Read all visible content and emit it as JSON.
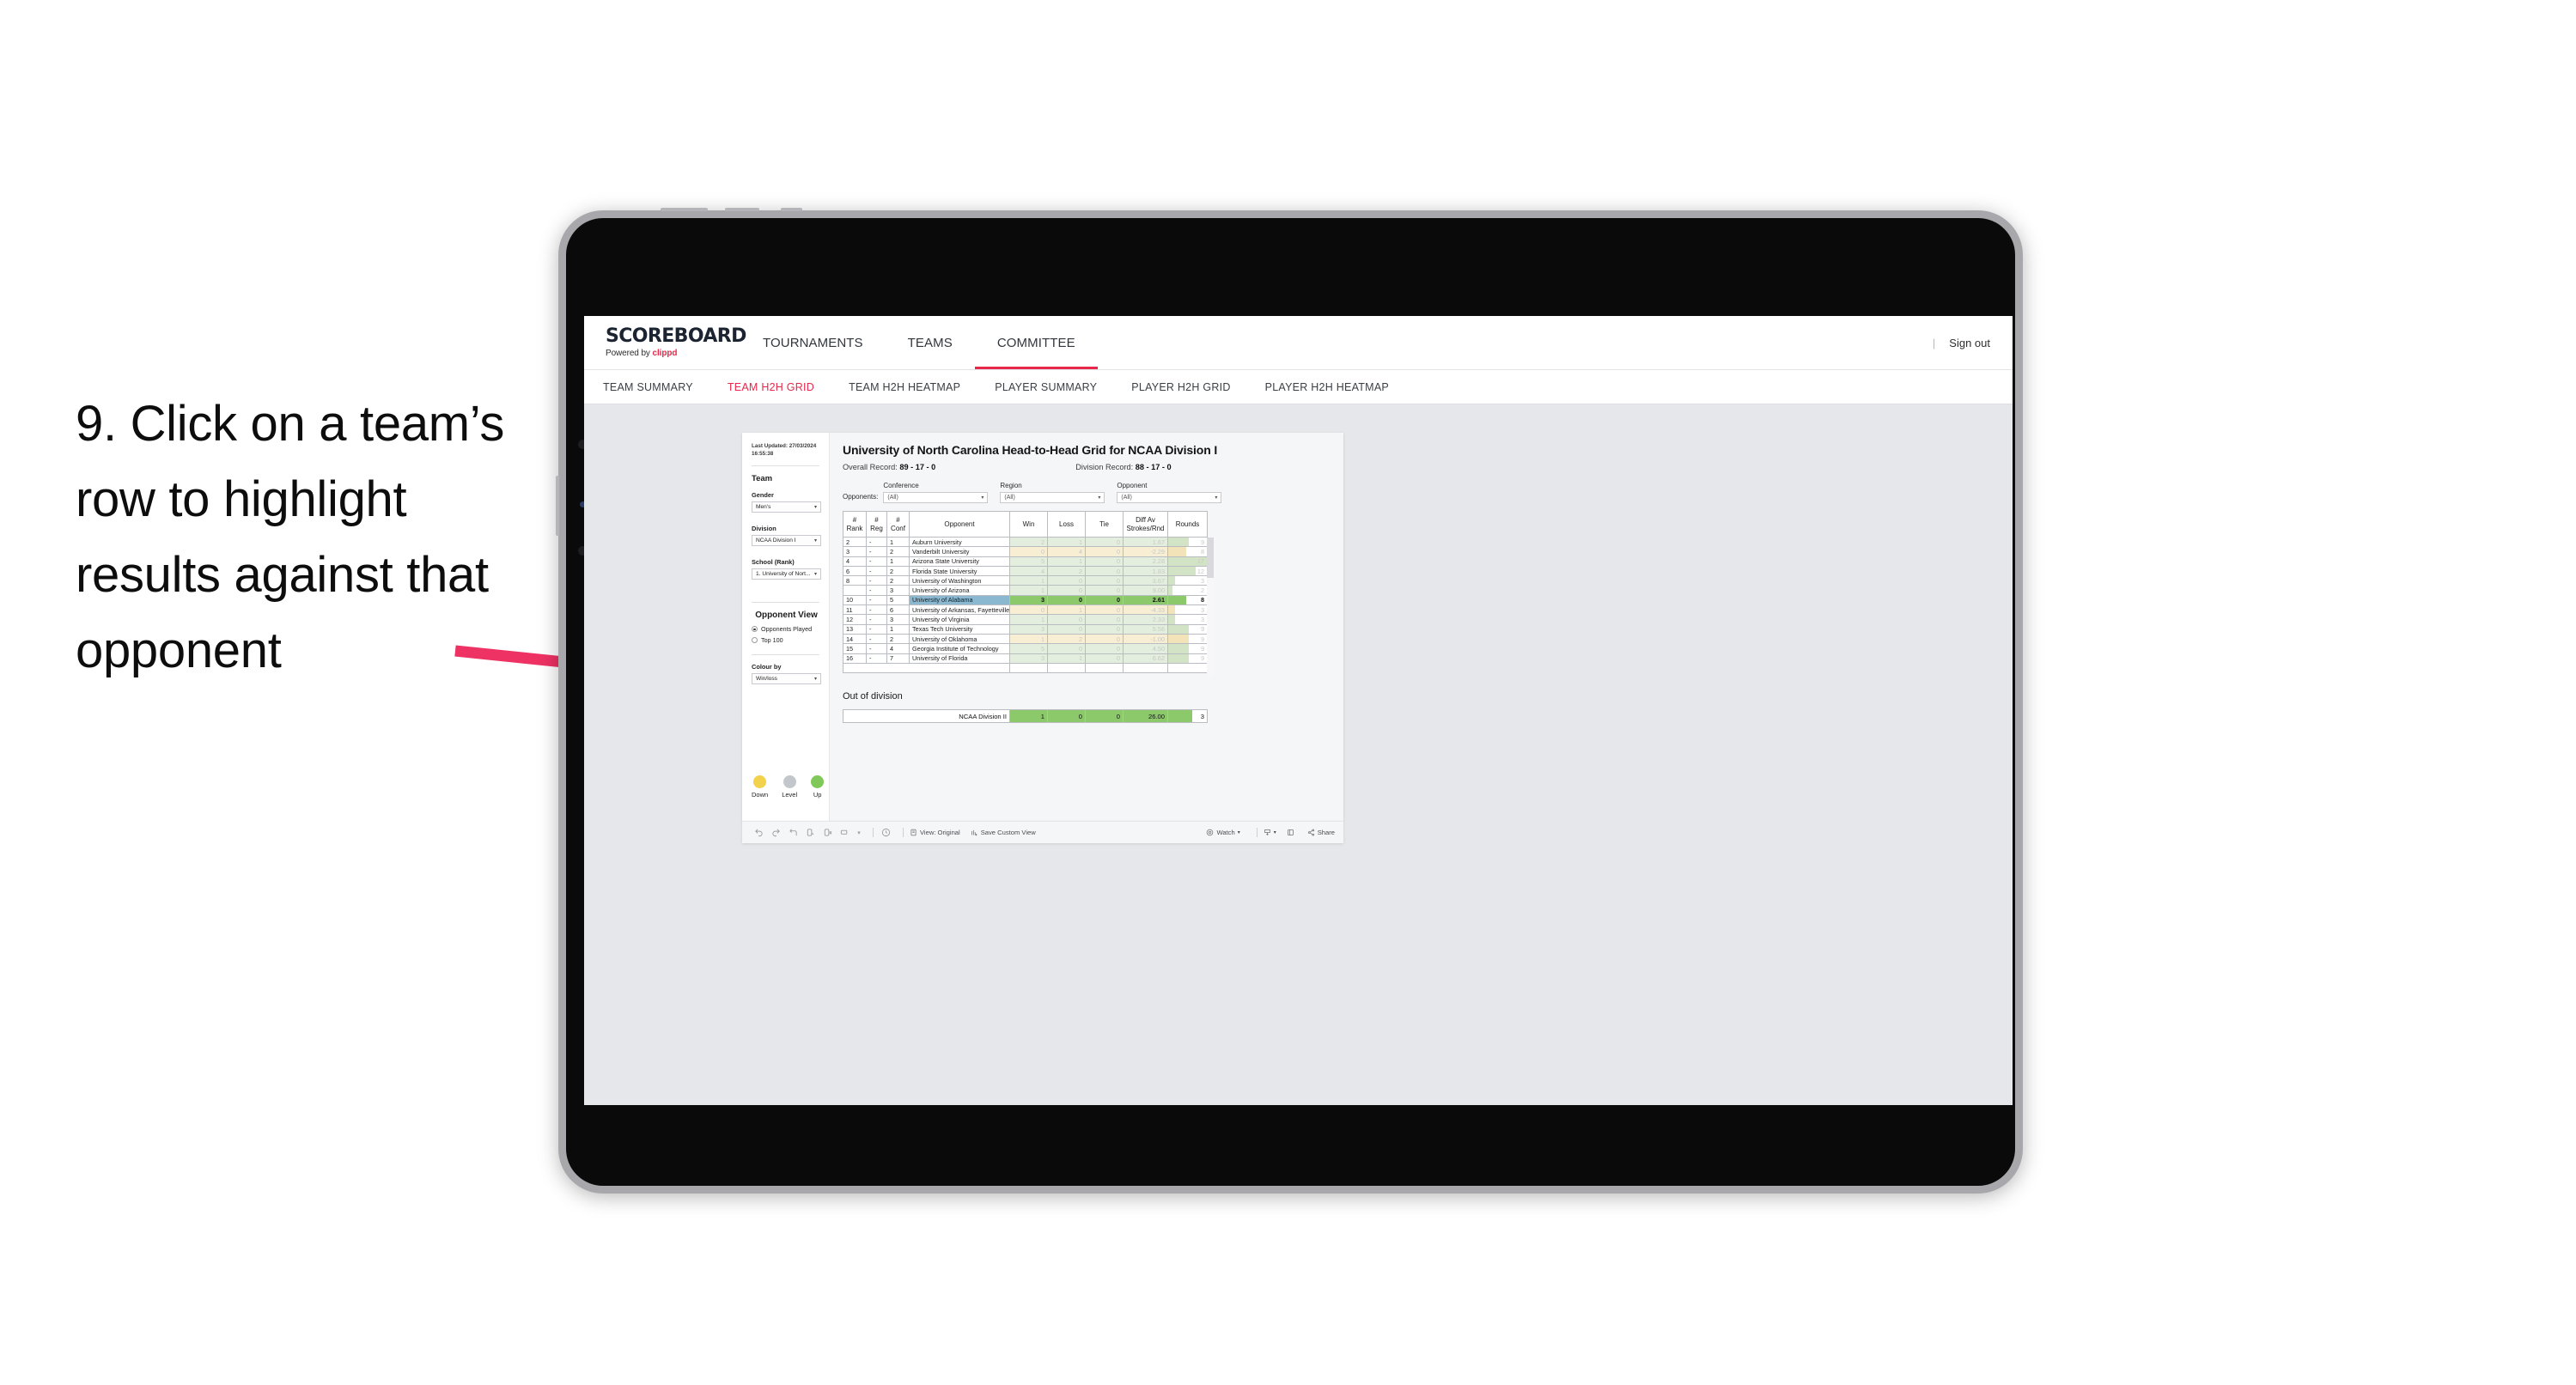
{
  "annotation": {
    "text": "9. Click on a team’s row to highlight results against that opponent",
    "arrow_color": "#ee3264"
  },
  "app": {
    "brand_name": "SCOREBOARD",
    "brand_sub_prefix": "Powered by ",
    "brand_sub_clippd": "clippd",
    "signout": "Sign out",
    "divider": "|",
    "topnav": [
      {
        "label": "TOURNAMENTS",
        "active": false
      },
      {
        "label": "TEAMS",
        "active": false
      },
      {
        "label": "COMMITTEE",
        "active": true
      }
    ],
    "subnav": [
      {
        "label": "TEAM SUMMARY",
        "active": false
      },
      {
        "label": "TEAM H2H GRID",
        "active": true
      },
      {
        "label": "TEAM H2H HEATMAP",
        "active": false
      },
      {
        "label": "PLAYER SUMMARY",
        "active": false
      },
      {
        "label": "PLAYER H2H GRID",
        "active": false
      },
      {
        "label": "PLAYER H2H HEATMAP",
        "active": false
      }
    ]
  },
  "sidebar": {
    "last_updated_line1": "Last Updated: 27/03/2024",
    "last_updated_line2": "16:55:38",
    "team_heading": "Team",
    "gender_label": "Gender",
    "gender_value": "Men’s",
    "division_label": "Division",
    "division_value": "NCAA Division I",
    "school_label": "School (Rank)",
    "school_value": "1. University of Nort...",
    "opponent_view_heading": "Opponent View",
    "opponent_view_options": [
      {
        "label": "Opponents Played",
        "selected": true
      },
      {
        "label": "Top 100",
        "selected": false
      }
    ],
    "colour_by_label": "Colour by",
    "colour_by_value": "Win/loss",
    "legend": [
      {
        "label": "Down",
        "color": "#f2d14b"
      },
      {
        "label": "Level",
        "color": "#c3c6cb"
      },
      {
        "label": "Up",
        "color": "#80c857"
      }
    ]
  },
  "main": {
    "title": "University of North Carolina Head-to-Head Grid for NCAA Division I",
    "overall_record_label": "Overall Record:",
    "overall_record_value": "89 - 17 - 0",
    "division_record_label": "Division Record:",
    "division_record_value": "88 - 17 - 0",
    "opponents_label": "Opponents:",
    "filters": [
      {
        "label": "Conference",
        "value": "(All)"
      },
      {
        "label": "Region",
        "value": "(All)"
      },
      {
        "label": "Opponent",
        "value": "(All)"
      }
    ],
    "columns": [
      "# Rank",
      "# Reg",
      "# Conf",
      "Opponent",
      "Win",
      "Loss",
      "Tie",
      "Diff Av Strokes/Rnd",
      "Rounds"
    ],
    "column_headers_2line": [
      {
        "l1": "#",
        "l2": "Rank"
      },
      {
        "l1": "#",
        "l2": "Reg"
      },
      {
        "l1": "#",
        "l2": "Conf"
      },
      {
        "l1": "Opponent",
        "l2": ""
      },
      {
        "l1": "Win",
        "l2": ""
      },
      {
        "l1": "Loss",
        "l2": ""
      },
      {
        "l1": "Tie",
        "l2": ""
      },
      {
        "l1": "Diff Av",
        "l2": "Strokes/Rnd"
      },
      {
        "l1": "Rounds",
        "l2": ""
      }
    ],
    "rows": [
      {
        "rank": "2",
        "reg": "-",
        "conf": "1",
        "opponent": "Auburn University",
        "win": "2",
        "loss": "1",
        "tie": "0",
        "diff": "1.67",
        "rounds": "9",
        "tone": "up",
        "highlight": false
      },
      {
        "rank": "3",
        "reg": "-",
        "conf": "2",
        "opponent": "Vanderbilt University",
        "win": "0",
        "loss": "4",
        "tie": "0",
        "diff": "-2.29",
        "rounds": "8",
        "tone": "down",
        "highlight": false
      },
      {
        "rank": "4",
        "reg": "-",
        "conf": "1",
        "opponent": "Arizona State University",
        "win": "5",
        "loss": "1",
        "tie": "0",
        "diff": "2.28",
        "rounds": "17",
        "tone": "up",
        "highlight": false
      },
      {
        "rank": "6",
        "reg": "-",
        "conf": "2",
        "opponent": "Florida State University",
        "win": "4",
        "loss": "2",
        "tie": "0",
        "diff": "1.83",
        "rounds": "12",
        "tone": "up",
        "highlight": false
      },
      {
        "rank": "8",
        "reg": "-",
        "conf": "2",
        "opponent": "University of Washington",
        "win": "1",
        "loss": "0",
        "tie": "0",
        "diff": "3.67",
        "rounds": "3",
        "tone": "up",
        "highlight": false
      },
      {
        "rank": "",
        "reg": "-",
        "conf": "3",
        "opponent": "University of Arizona",
        "win": "1",
        "loss": "0",
        "tie": "0",
        "diff": "9.00",
        "rounds": "2",
        "tone": "up",
        "highlight": false
      },
      {
        "rank": "10",
        "reg": "-",
        "conf": "5",
        "opponent": "University of Alabama",
        "win": "3",
        "loss": "0",
        "tie": "0",
        "diff": "2.61",
        "rounds": "8",
        "tone": "up",
        "highlight": true
      },
      {
        "rank": "11",
        "reg": "-",
        "conf": "6",
        "opponent": "University of Arkansas, Fayetteville",
        "win": "0",
        "loss": "1",
        "tie": "0",
        "diff": "-4.33",
        "rounds": "3",
        "tone": "down",
        "highlight": false
      },
      {
        "rank": "12",
        "reg": "-",
        "conf": "3",
        "opponent": "University of Virginia",
        "win": "1",
        "loss": "0",
        "tie": "0",
        "diff": "2.33",
        "rounds": "3",
        "tone": "up",
        "highlight": false
      },
      {
        "rank": "13",
        "reg": "-",
        "conf": "1",
        "opponent": "Texas Tech University",
        "win": "3",
        "loss": "0",
        "tie": "0",
        "diff": "5.56",
        "rounds": "9",
        "tone": "up",
        "highlight": false
      },
      {
        "rank": "14",
        "reg": "-",
        "conf": "2",
        "opponent": "University of Oklahoma",
        "win": "1",
        "loss": "2",
        "tie": "0",
        "diff": "-1.00",
        "rounds": "9",
        "tone": "down",
        "highlight": false
      },
      {
        "rank": "15",
        "reg": "-",
        "conf": "4",
        "opponent": "Georgia Institute of Technology",
        "win": "5",
        "loss": "0",
        "tie": "0",
        "diff": "4.50",
        "rounds": "9",
        "tone": "up",
        "highlight": false
      },
      {
        "rank": "16",
        "reg": "-",
        "conf": "7",
        "opponent": "University of Florida",
        "win": "3",
        "loss": "1",
        "tie": "0",
        "diff": "6.62",
        "rounds": "9",
        "tone": "up",
        "highlight": false
      }
    ],
    "out_of_division_heading": "Out of division",
    "out_of_division_row": {
      "label": "NCAA Division II",
      "win": "1",
      "loss": "0",
      "tie": "0",
      "diff": "26.00",
      "rounds": "3"
    }
  },
  "toolbar": {
    "view_label": "View: Original",
    "save_label": "Save Custom View",
    "watch_label": "Watch",
    "share_label": "Share",
    "icons": [
      "undo-icon",
      "redo-icon",
      "revert-icon",
      "refresh-icon",
      "pause-icon",
      "highlight-icon",
      "caret-down-icon",
      "clock-icon"
    ]
  },
  "chart_data": {
    "type": "table",
    "title": "University of North Carolina Head-to-Head Grid for NCAA Division I",
    "categories": [
      "Auburn University",
      "Vanderbilt University",
      "Arizona State University",
      "Florida State University",
      "University of Washington",
      "University of Arizona",
      "University of Alabama",
      "University of Arkansas, Fayetteville",
      "University of Virginia",
      "Texas Tech University",
      "University of Oklahoma",
      "Georgia Institute of Technology",
      "University of Florida"
    ],
    "series": [
      {
        "name": "Win",
        "values": [
          2,
          0,
          5,
          4,
          1,
          1,
          3,
          0,
          1,
          3,
          1,
          5,
          3
        ]
      },
      {
        "name": "Loss",
        "values": [
          1,
          4,
          1,
          2,
          0,
          0,
          0,
          1,
          0,
          0,
          2,
          0,
          1
        ]
      },
      {
        "name": "Tie",
        "values": [
          0,
          0,
          0,
          0,
          0,
          0,
          0,
          0,
          0,
          0,
          0,
          0,
          0
        ]
      },
      {
        "name": "Diff Av Strokes/Rnd",
        "values": [
          1.67,
          -2.29,
          2.28,
          1.83,
          3.67,
          9.0,
          2.61,
          -4.33,
          2.33,
          5.56,
          -1.0,
          4.5,
          6.62
        ]
      },
      {
        "name": "Rounds",
        "values": [
          9,
          8,
          17,
          12,
          3,
          2,
          8,
          3,
          3,
          9,
          9,
          9,
          9
        ]
      }
    ],
    "legend": [
      "Down",
      "Level",
      "Up"
    ],
    "colors": {
      "up": "#e4eede",
      "down": "#f7eed4",
      "highlight_row": "#8ab8d0",
      "highlight_value": "#8bc96a"
    }
  }
}
